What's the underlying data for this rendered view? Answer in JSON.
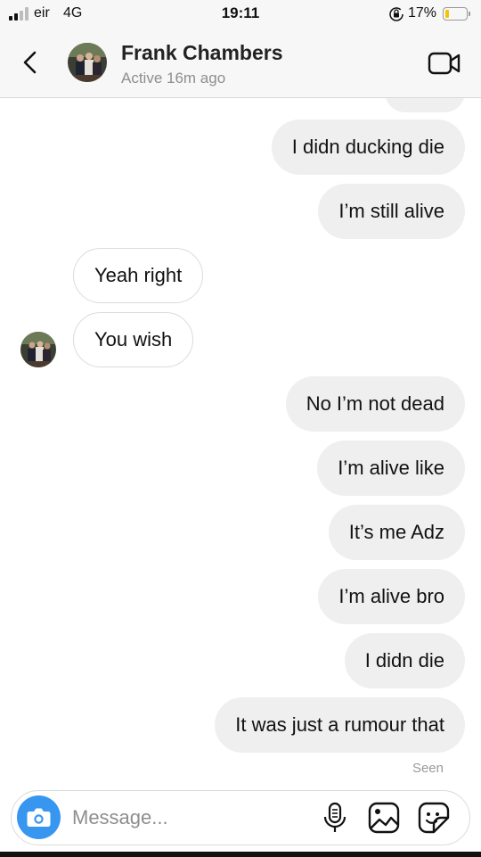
{
  "status_bar": {
    "carrier": "eir",
    "network": "4G",
    "time": "19:11",
    "battery_percent": "17%",
    "battery_level": 0.17,
    "battery_color": "#f5c400",
    "signal_bars": 4,
    "signal_bars_filled": 2
  },
  "header": {
    "back_icon": "chevron-left-icon",
    "contact_name": "Frank Chambers",
    "contact_status": "Active 16m ago",
    "video_icon": "video-call-icon"
  },
  "messages": [
    {
      "direction": "out",
      "text": "I didn ducking die"
    },
    {
      "direction": "out",
      "text": "I’m still alive"
    },
    {
      "direction": "in",
      "text": "Yeah right"
    },
    {
      "direction": "in",
      "text": "You wish",
      "show_avatar": true
    },
    {
      "direction": "out",
      "text": "No I’m not dead"
    },
    {
      "direction": "out",
      "text": "I’m alive like"
    },
    {
      "direction": "out",
      "text": "It’s me Adz"
    },
    {
      "direction": "out",
      "text": "I’m alive bro"
    },
    {
      "direction": "out",
      "text": "I didn die"
    },
    {
      "direction": "out",
      "text": "It was just a rumour that"
    }
  ],
  "seen_label": "Seen",
  "composer": {
    "placeholder": "Message...",
    "value": "",
    "camera_icon": "camera-icon",
    "mic_icon": "microphone-icon",
    "gallery_icon": "gallery-icon",
    "sticker_icon": "sticker-icon",
    "accent_color": "#3797f0"
  },
  "colors": {
    "outgoing_bubble": "#efefef",
    "incoming_border": "#dbdbdb",
    "secondary_text": "#8e8e8e"
  }
}
